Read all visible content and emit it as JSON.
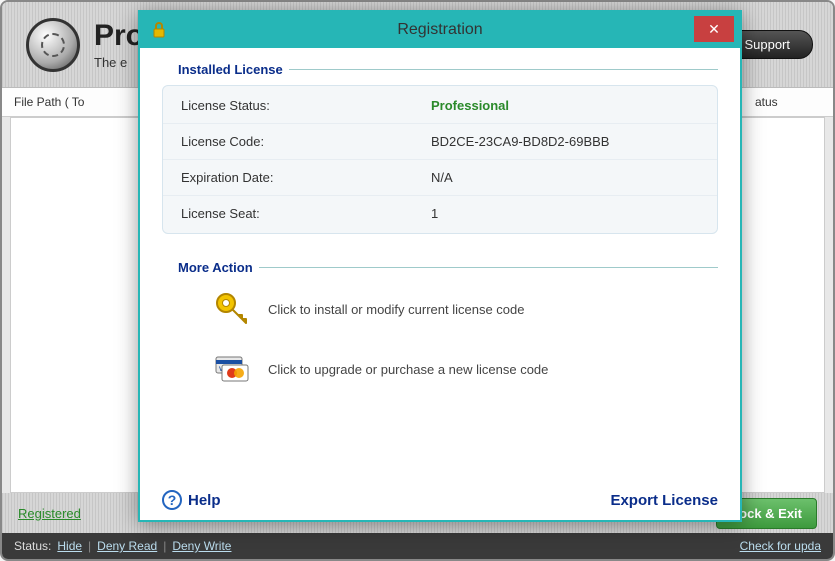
{
  "app": {
    "title_prefix": "Pro",
    "subtitle_prefix": "The e",
    "support_label": "Support"
  },
  "columns": {
    "left": "File Path  ( To",
    "right": "atus"
  },
  "footer": {
    "registered": "Registered",
    "lock_exit": "Lock & Exit"
  },
  "status": {
    "label": "Status:",
    "hide": "Hide",
    "deny_read": "Deny Read",
    "deny_write": "Deny Write",
    "check": "Check for upda"
  },
  "modal": {
    "title": "Registration",
    "group1": "Installed License",
    "rows": {
      "status_k": "License Status:",
      "status_v": "Professional",
      "code_k": "License Code:",
      "code_v": "BD2CE-23CA9-BD8D2-69BBB",
      "expire_k": "Expiration Date:",
      "expire_v": "N/A",
      "seat_k": "License Seat:",
      "seat_v": "1"
    },
    "group2": "More Action",
    "action1": "Click to install or modify current license code",
    "action2": "Click to upgrade or purchase a new license code",
    "help": "Help",
    "export": "Export License"
  }
}
